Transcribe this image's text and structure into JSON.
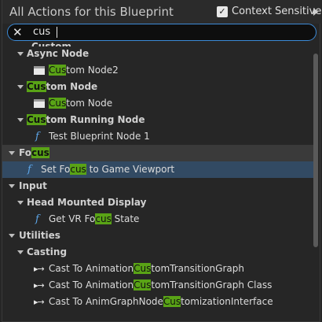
{
  "header": {
    "title": "All Actions for this Blueprint",
    "context_sensitive_label": "Context Sensitive",
    "context_sensitive_checked": true
  },
  "search": {
    "value": "cus"
  },
  "tree": {
    "partial_top": "Custom",
    "rows": [
      {
        "kind": "cat",
        "pre": "Async Node",
        "hl": "",
        "post": ""
      },
      {
        "kind": "leaf",
        "icon": "node",
        "pre": "",
        "hl": "Cus",
        "post": "tom Node2"
      },
      {
        "kind": "cat",
        "pre": "",
        "hl": "Cus",
        "post": "tom Node"
      },
      {
        "kind": "leaf",
        "icon": "node",
        "pre": "",
        "hl": "Cus",
        "post": "tom Node"
      },
      {
        "kind": "cat",
        "pre": "",
        "hl": "Cus",
        "post": "tom Running Node"
      },
      {
        "kind": "leaf",
        "icon": "fn",
        "pre": "Test Blueprint Node 1",
        "hl": "",
        "post": ""
      },
      {
        "kind": "cat",
        "pre": "Fo",
        "hl": "cus",
        "post": ""
      },
      {
        "kind": "leaf",
        "icon": "fn",
        "pre": "Set Fo",
        "hl": "cus",
        "post": " to Game Viewport"
      },
      {
        "kind": "cat",
        "pre": "Input",
        "hl": "",
        "post": ""
      },
      {
        "kind": "cat",
        "pre": "Head Mounted Display",
        "hl": "",
        "post": ""
      },
      {
        "kind": "leaf",
        "icon": "fn",
        "pre": "Get VR Fo",
        "hl": "cus",
        "post": " State"
      },
      {
        "kind": "cat",
        "pre": "Utilities",
        "hl": "",
        "post": ""
      },
      {
        "kind": "cat",
        "pre": "Casting",
        "hl": "",
        "post": ""
      },
      {
        "kind": "leaf",
        "icon": "cast",
        "pre": "Cast To Animation",
        "hl": "Cus",
        "post": "tomTransitionGraph"
      },
      {
        "kind": "leaf",
        "icon": "cast",
        "pre": "Cast To Animation",
        "hl": "Cus",
        "post": "tomTransitionGraph Class"
      },
      {
        "kind": "leaf",
        "icon": "cast",
        "pre": "Cast To AnimGraphNode",
        "hl": "Cus",
        "post": "tomizationInterface"
      }
    ]
  },
  "icons": {
    "clear": "close-icon",
    "node": "node-icon",
    "function": "function-icon",
    "cast": "cast-icon",
    "expand": "chevron-down-icon"
  },
  "colors": {
    "highlight": "#59a316",
    "selected_row": "#324a63",
    "search_border": "#3c8ad6",
    "function_icon": "#5da6e8"
  }
}
